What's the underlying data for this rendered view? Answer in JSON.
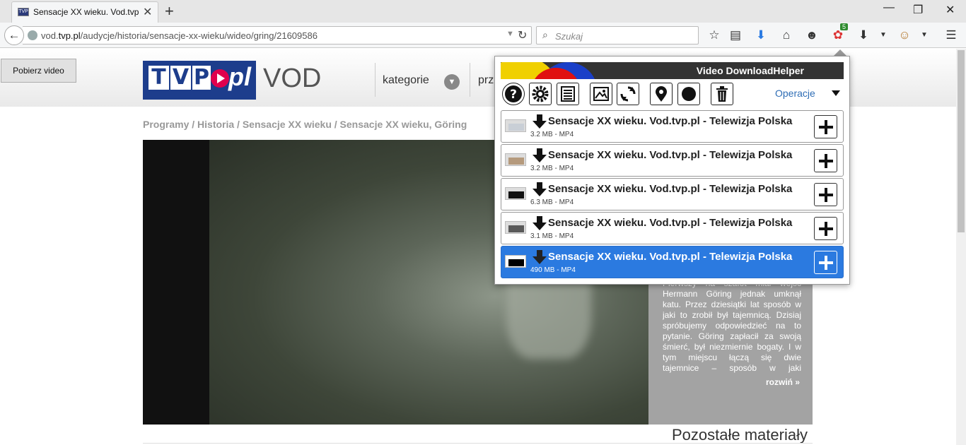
{
  "browser": {
    "tab_title": "Sensacje XX wieku. Vod.tvp.pl",
    "tab_close": "✕",
    "new_tab": "+",
    "url_prefix": "vod.",
    "url_domain": "tvp.pl",
    "url_path": "/audycje/historia/sensacje-xx-wieku/wideo/gring/21609586",
    "search_placeholder": "Szukaj",
    "addon_badge": "5"
  },
  "page": {
    "pobierz_button": "Pobierz video",
    "logo_letters": [
      "T",
      "V",
      "P"
    ],
    "logo_pl": "pl",
    "logo_vod": "VOD",
    "nav_kategorie": "kategorie",
    "nav_second": "prze",
    "breadcrumb": "Programy / Historia / Sensacje XX wieku / Sensacje XX wieku, Göring",
    "description": "Pierwszy na szafot miał wejść Hermann Göring jednak umknął katu. Przez dziesiątki lat sposób w jaki to zrobił był tajemnicą. Dzisiaj spróbujemy odpowiedzieć na to pytanie. Göring zapłacił za swoją śmierć, był niezmiernie bogaty. I w tym miejscu łączą się dwie tajemnice – sposób w jaki zgromadził skarby i jak nimi zapłacił",
    "description_more": "rozwiń »",
    "other_materials": "Pozostałe materiały"
  },
  "popup": {
    "title": "Video DownloadHelper",
    "operations_label": "Operacje",
    "toolbar_icons": [
      "help-icon",
      "settings-icon",
      "list-icon",
      "image-icon",
      "convert-icon",
      "location-icon",
      "record-icon",
      "trash-icon"
    ],
    "items": [
      {
        "title": "Sensacje XX wieku. Vod.tvp.pl - Telewizja Polska",
        "meta": "3.2 MB - MP4",
        "selected": false,
        "thumb": "#c9cfd6"
      },
      {
        "title": "Sensacje XX wieku. Vod.tvp.pl - Telewizja Polska",
        "meta": "3.2 MB - MP4",
        "selected": false,
        "thumb": "#b59a7d"
      },
      {
        "title": "Sensacje XX wieku. Vod.tvp.pl - Telewizja Polska",
        "meta": "6.3 MB - MP4",
        "selected": false,
        "thumb": "#111111"
      },
      {
        "title": "Sensacje XX wieku. Vod.tvp.pl - Telewizja Polska",
        "meta": "3.1 MB - MP4",
        "selected": false,
        "thumb": "#5a5a5a"
      },
      {
        "title": "Sensacje XX wieku. Vod.tvp.pl - Telewizja Polska",
        "meta": "490 MB - MP4",
        "selected": true,
        "thumb": "#000000"
      }
    ]
  },
  "colors": {
    "tvp_blue": "#1d3d8c",
    "tvp_red": "#e0004d",
    "selection_blue": "#2b7ae0",
    "operations_link": "#2e6db5"
  }
}
